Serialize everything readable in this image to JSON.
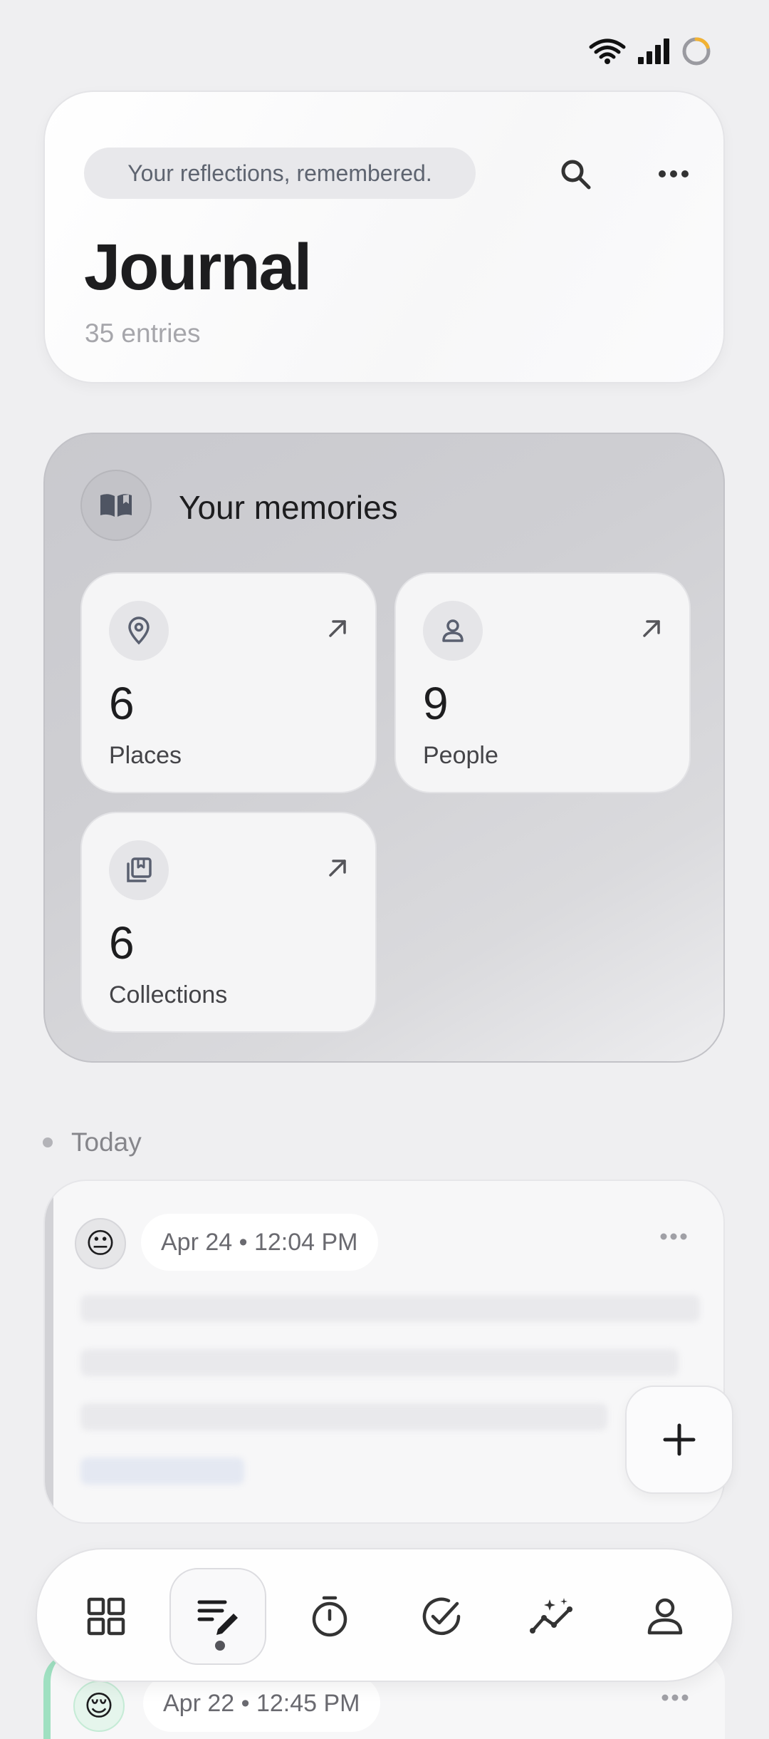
{
  "header": {
    "tagline": "Your reflections, remembered.",
    "title": "Journal",
    "entry_count": "35 entries"
  },
  "memories": {
    "title": "Your memories",
    "stats": [
      {
        "value": "6",
        "label": "Places",
        "icon": "map-pin-icon"
      },
      {
        "value": "9",
        "label": "People",
        "icon": "person-icon"
      },
      {
        "value": "6",
        "label": "Collections",
        "icon": "collection-icon"
      }
    ]
  },
  "today": {
    "label": "Today",
    "entry": {
      "mood": "😐",
      "date": "Apr 24 • 12:04 PM"
    }
  },
  "next_entry": {
    "mood": "😌",
    "date": "Apr 22 • 12:45 PM"
  },
  "nav": {
    "items": [
      "dashboard-icon",
      "journal-icon",
      "timer-icon",
      "check-icon",
      "insights-icon",
      "profile-icon"
    ],
    "active_index": 1
  },
  "colors": {
    "background": "#efeff1",
    "memories_bg": "#cfcfd3",
    "accent_progress": "#f2b233"
  }
}
